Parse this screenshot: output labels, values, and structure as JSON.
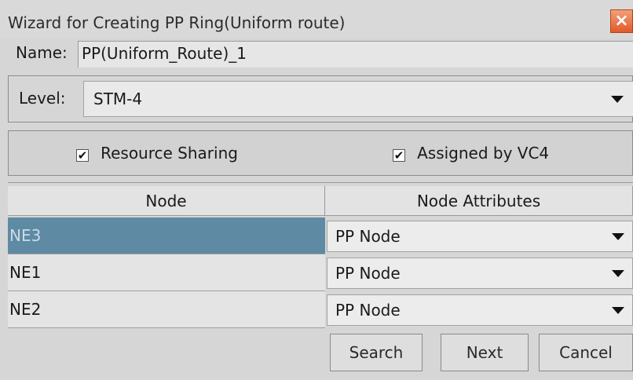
{
  "window": {
    "title": "Wizard for Creating PP Ring(Uniform route)",
    "close_icon": "close-icon"
  },
  "name": {
    "label": "Name:",
    "value": "PP(Uniform_Route)_1"
  },
  "level": {
    "label": "Level:",
    "value": "STM-4"
  },
  "options": {
    "resource_sharing": {
      "label": "Resource Sharing",
      "checked": true
    },
    "assigned_by_vc4": {
      "label": "Assigned by VC4",
      "checked": true
    }
  },
  "table": {
    "columns": [
      "Node",
      "Node Attributes"
    ],
    "rows": [
      {
        "node": "NE3",
        "attribute": "PP Node",
        "selected": true
      },
      {
        "node": "NE1",
        "attribute": "PP Node",
        "selected": false
      },
      {
        "node": "NE2",
        "attribute": "PP Node",
        "selected": false
      }
    ]
  },
  "buttons": {
    "search": "Search",
    "next": "Next",
    "cancel": "Cancel"
  },
  "colors": {
    "selected_row": "#5f8aa3",
    "close_button": "#e05a2a"
  }
}
